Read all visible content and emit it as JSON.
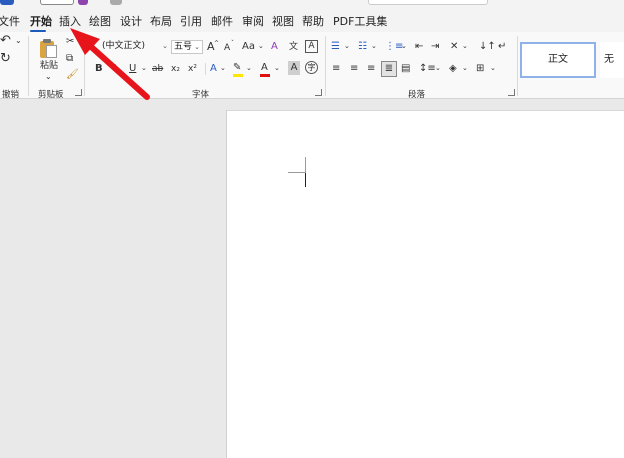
{
  "menu": {
    "tabs": [
      "文件",
      "开始",
      "插入",
      "绘图",
      "设计",
      "布局",
      "引用",
      "邮件",
      "审阅",
      "视图",
      "帮助",
      "PDF工具集"
    ],
    "active_tab": "开始"
  },
  "ribbon": {
    "undo_group_label": "撤销",
    "clipboard": {
      "paste_label": "粘贴",
      "group_label": "剪贴板"
    },
    "font": {
      "font_name": "(中文正文)",
      "font_size": "五号",
      "grow_label": "A",
      "shrink_label": "A",
      "case_label": "Aa",
      "bold": "B",
      "italic": "I",
      "underline": "U",
      "strike": "ab",
      "subscript": "x₂",
      "superscript": "x²",
      "font_color_label": "A",
      "shade_label": "A",
      "group_label": "字体"
    },
    "paragraph": {
      "group_label": "段落"
    },
    "styles": {
      "normal": "正文",
      "next": "无"
    }
  },
  "colors": {
    "accent": "#185abd",
    "highlight": "#ffe600",
    "font_color": "#e01010",
    "arrow": "#e8141b"
  }
}
